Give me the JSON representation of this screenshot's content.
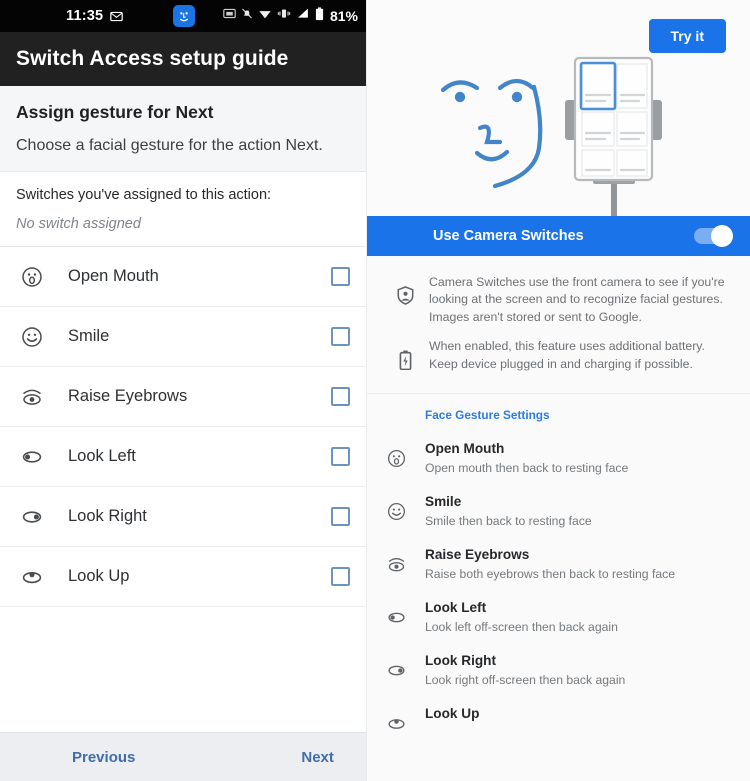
{
  "left": {
    "statusbar": {
      "time": "11:35",
      "battery_percent": "81%",
      "icons": [
        "message-icon",
        "face-badge-icon",
        "screenshot-icon",
        "notifications-muted-icon",
        "wifi-icon",
        "vibrate-icon",
        "signal-icon",
        "battery-icon"
      ]
    },
    "appbar": {
      "title": "Switch Access setup guide"
    },
    "header": {
      "title": "Assign gesture for Next",
      "subtitle": "Choose a facial gesture for the action Next."
    },
    "assigned": {
      "label": "Switches you've assigned to this action:",
      "value": "No switch assigned"
    },
    "gestures": [
      {
        "icon": "open-mouth-icon",
        "label": "Open Mouth",
        "checked": false
      },
      {
        "icon": "smile-icon",
        "label": "Smile",
        "checked": false
      },
      {
        "icon": "raise-eyebrows-icon",
        "label": "Raise Eyebrows",
        "checked": false
      },
      {
        "icon": "look-left-icon",
        "label": "Look Left",
        "checked": false
      },
      {
        "icon": "look-right-icon",
        "label": "Look Right",
        "checked": false
      },
      {
        "icon": "look-up-icon",
        "label": "Look Up",
        "checked": false
      }
    ],
    "nav": {
      "previous": "Previous",
      "next": "Next"
    }
  },
  "right": {
    "hero": {
      "try_button": "Try it",
      "illustration": "face-and-phone-on-stand-illustration"
    },
    "toggle": {
      "label": "Use Camera Switches",
      "enabled": true
    },
    "info": [
      {
        "icon": "privacy-shield-icon",
        "text": "Camera Switches use the front camera to see if you're looking at the screen and to recognize facial gestures. Images aren't stored or sent to Google."
      },
      {
        "icon": "battery-charging-icon",
        "text": "When enabled, this feature uses additional battery. Keep device plugged in and charging if possible."
      }
    ],
    "face_gesture_settings": {
      "header": "Face Gesture Settings",
      "rows": [
        {
          "icon": "open-mouth-icon",
          "title": "Open Mouth",
          "desc": "Open mouth then back to resting face"
        },
        {
          "icon": "smile-icon",
          "title": "Smile",
          "desc": "Smile then back to resting face"
        },
        {
          "icon": "raise-eyebrows-icon",
          "title": "Raise Eyebrows",
          "desc": "Raise both eyebrows then back to resting face"
        },
        {
          "icon": "look-left-icon",
          "title": "Look Left",
          "desc": "Look left off-screen then back again"
        },
        {
          "icon": "look-right-icon",
          "title": "Look Right",
          "desc": "Look right off-screen then back again"
        },
        {
          "icon": "look-up-icon",
          "title": "Look Up",
          "desc": ""
        }
      ]
    }
  },
  "colors": {
    "accent_blue": "#1a73e8",
    "appbar_dark": "#212121",
    "statusbar_black": "#040404",
    "link_blue": "#3f6ea8",
    "section_header_blue": "#2b7de0"
  }
}
